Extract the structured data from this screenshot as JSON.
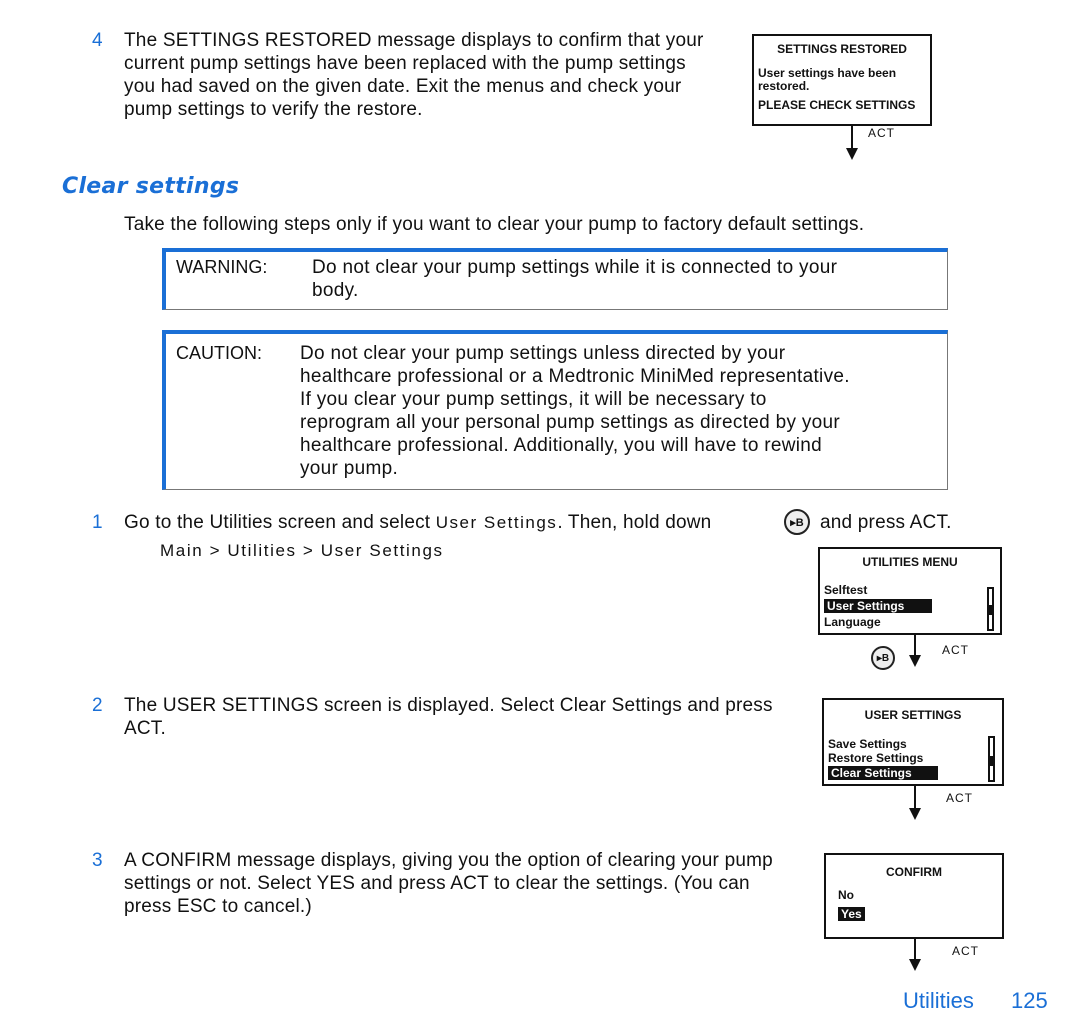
{
  "step4": {
    "number": "4",
    "lines": [
      "The SETTINGS RESTORED message displays to confirm that your",
      "current pump settings have been replaced with the pump settings",
      "you had saved on the given date. Exit the menus and check your",
      "pump settings to verify the restore."
    ]
  },
  "restored_screen": {
    "title": "SETTINGS RESTORED",
    "line1": "User settings have been",
    "line2": "restored.",
    "line3": "PLEASE CHECK SETTINGS",
    "act": "ACT"
  },
  "section": {
    "heading": "Clear settings",
    "intro": "Take the following steps only if you want to clear your pump to factory default settings."
  },
  "warning": {
    "label": "WARNING:",
    "lines": [
      "Do not clear your pump settings while it is connected to your",
      "body."
    ]
  },
  "caution": {
    "label": "CAUTION:",
    "lines": [
      "Do not clear your pump settings unless directed by your",
      "healthcare professional or a Medtronic MiniMed representative.",
      "If you clear your pump settings, it will be necessary to",
      "reprogram all your personal pump settings as directed by your",
      "healthcare professional. Additionally, you will have to rewind",
      "your pump."
    ]
  },
  "step1": {
    "number": "1",
    "text_a": "Go to the Utilities screen and select",
    "menu_item": "User Settings",
    "text_b": ". Then, hold down",
    "button_icon": "B",
    "text_c": "and press ACT.",
    "path": "Main > Utilities > User Settings"
  },
  "utilities_screen": {
    "title": "UTILITIES MENU",
    "items": [
      "Selftest",
      "User Settings",
      "Language"
    ],
    "selected": "User Settings",
    "button_icon": "B",
    "act": "ACT"
  },
  "step2": {
    "number": "2",
    "lines": [
      "The USER SETTINGS screen is displayed. Select Clear Settings and press",
      "ACT."
    ]
  },
  "user_settings_screen": {
    "title": "USER SETTINGS",
    "items": [
      "Save Settings",
      "Restore Settings",
      "Clear Settings"
    ],
    "selected": "Clear Settings",
    "act": "ACT"
  },
  "step3": {
    "number": "3",
    "lines": [
      "A CONFIRM message displays, giving you the option of clearing your pump",
      "settings or not. Select YES and press ACT to clear the settings. (You can",
      "press ESC to cancel.)"
    ]
  },
  "confirm_screen": {
    "title": "CONFIRM",
    "items": [
      "No",
      "Yes"
    ],
    "selected": "Yes",
    "act": "ACT"
  },
  "footer": {
    "section": "Utilities",
    "page": "125"
  },
  "colors": {
    "accent": "#1a6fd6",
    "text": "#111111"
  }
}
